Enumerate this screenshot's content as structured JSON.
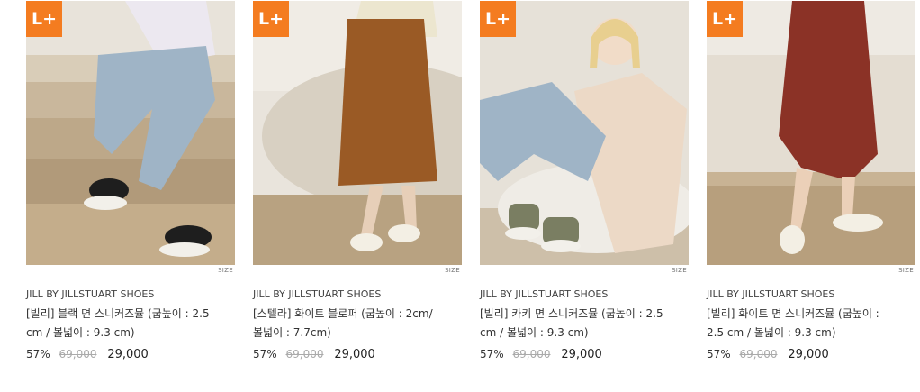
{
  "products": [
    {
      "badge": "L+",
      "size_label": "SIZE",
      "brand": "JILL BY JILLSTUART SHOES",
      "name": "[빌리] 블랙 면 스니커즈뮬 (굽높이 : 2.5 cm / 볼넓이 : 9.3 cm)",
      "discount": "57%",
      "original_price": "69,000",
      "sale_price": "29,000"
    },
    {
      "badge": "L+",
      "size_label": "SIZE",
      "brand": "JILL BY JILLSTUART SHOES",
      "name": "[스텔라] 화이트 블로퍼 (굽높이 : 2cm/볼넓이 : 7.7cm)",
      "discount": "57%",
      "original_price": "69,000",
      "sale_price": "29,000"
    },
    {
      "badge": "L+",
      "size_label": "SIZE",
      "brand": "JILL BY JILLSTUART SHOES",
      "name": "[빌리] 카키 면 스니커즈뮬 (굽높이 : 2.5 cm / 볼넓이 : 9.3 cm)",
      "discount": "57%",
      "original_price": "69,000",
      "sale_price": "29,000"
    },
    {
      "badge": "L+",
      "size_label": "SIZE",
      "brand": "JILL BY JILLSTUART SHOES",
      "name": "[빌리] 화이트 면 스니커즈뮬 (굽높이 : 2.5 cm / 볼넓이 : 9.3 cm)",
      "discount": "57%",
      "original_price": "69,000",
      "sale_price": "29,000"
    }
  ],
  "colors": {
    "badge": "#f47c20",
    "original_price": "#aaaaaa"
  }
}
